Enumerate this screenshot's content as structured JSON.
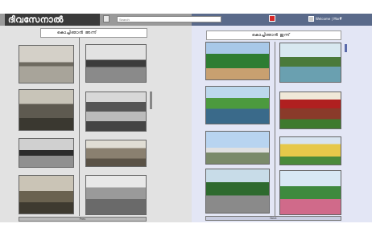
{
  "app": {
    "logo_text": "ദിവസേനാൽ"
  },
  "header": {
    "search_placeholder": "Search",
    "user_label": "Welcome | More",
    "caret": "▾"
  },
  "left_panel": {
    "title": "കൊച്ചിഞാൻ  അന്ന്",
    "pager_label": "Prev",
    "photos": [
      {
        "name": "boat-jetty-1900",
        "tone": "sepia"
      },
      {
        "name": "backwater-trees",
        "tone": "bw"
      },
      {
        "name": "houseboat",
        "tone": "sepia"
      },
      {
        "name": "temple-gopuram",
        "tone": "bw"
      },
      {
        "name": "airplanes",
        "tone": "bw"
      },
      {
        "name": "colonial-building",
        "tone": "sepia"
      },
      {
        "name": "railway-station",
        "tone": "sepia"
      },
      {
        "name": "crowd-street",
        "tone": "bw"
      }
    ]
  },
  "right_panel": {
    "title": "കൊച്ചിഞാൻ  ഇന്ന്",
    "pager_label": "Next",
    "photos": [
      {
        "name": "resort-greenery",
        "tone": "color"
      },
      {
        "name": "lake-houses",
        "tone": "color"
      },
      {
        "name": "rower-backwater",
        "tone": "color"
      },
      {
        "name": "temple-modern",
        "tone": "color"
      },
      {
        "name": "airport-jets",
        "tone": "color"
      },
      {
        "name": "modern-palace",
        "tone": "color"
      },
      {
        "name": "train-tracks",
        "tone": "color"
      },
      {
        "name": "park-pavilion",
        "tone": "color"
      }
    ]
  }
}
